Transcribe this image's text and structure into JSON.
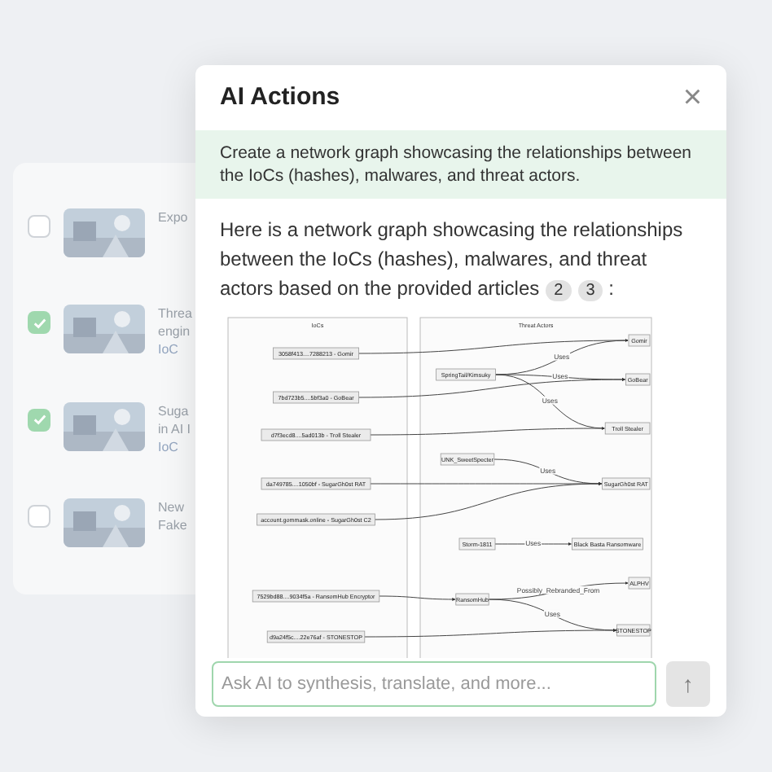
{
  "background_list": [
    {
      "checked": false,
      "lines": [
        "Expo"
      ]
    },
    {
      "checked": true,
      "lines": [
        "Threa",
        "engin"
      ],
      "source": "IoC"
    },
    {
      "checked": true,
      "lines": [
        "Suga",
        "in AI I"
      ],
      "source": "IoC"
    },
    {
      "checked": false,
      "lines": [
        "New",
        "Fake"
      ]
    }
  ],
  "dialog": {
    "title": "AI Actions",
    "close": "×",
    "prompt": "Create a network graph showcasing the relationships between the IoCs (hashes), malwares, and threat actors.",
    "answer": "Here is a network graph showcasing the relationships between the IoCs (hashes), malwares, and threat actors based on the provided articles",
    "citations": [
      "2",
      "3"
    ],
    "answer_end": ":",
    "graph": {
      "clusters": [
        "IoCs",
        "Threat Actors"
      ],
      "ioc_nodes": [
        "3058f413....7288213 - Gomir",
        "7bd723b5....5bf3a0 - GoBear",
        "d7f3ecd8....5ad013b - Troll Stealer",
        "da749785....1050bf - SugarGh0st RAT",
        "account.gommask.online - SugarGh0st C2",
        "7529bd88....9034f5a - RansomHub Encryptor",
        "d9a24f5c....22e76af - STONESTOP"
      ],
      "actor_nodes": [
        "SpringTail/Kimsuky",
        "Gomir",
        "GoBear",
        "Troll Stealer",
        "UNK_SweetSpecter",
        "SugarGh0st RAT",
        "Storm-1811",
        "Black Basta Ransomware",
        "RansomHub",
        "ALPHV",
        "STONESTOP"
      ],
      "edge_labels": [
        "Uses",
        "Uses",
        "Uses",
        "Uses",
        "Uses",
        "Possibly_Rebranded_From",
        "Uses"
      ]
    },
    "input": {
      "placeholder": "Ask AI to synthesis, translate, and more..."
    },
    "send": "↑"
  }
}
